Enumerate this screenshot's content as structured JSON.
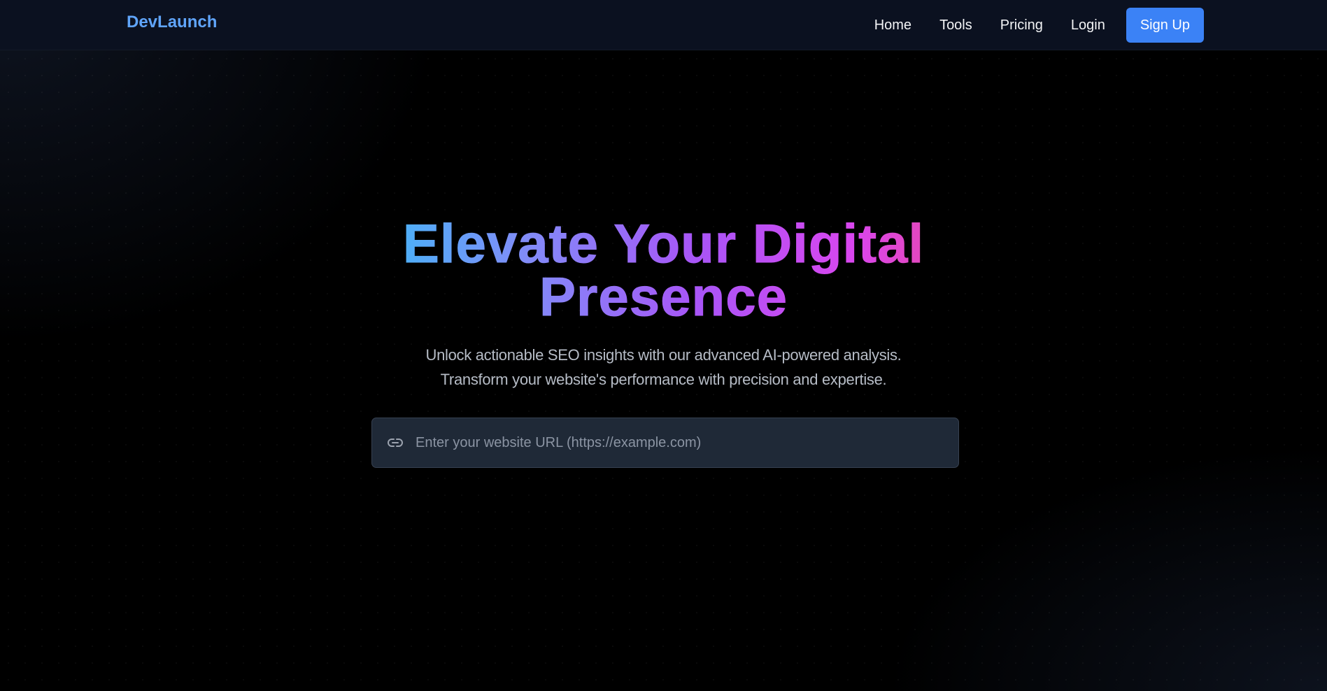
{
  "navbar": {
    "brand": "DevLaunch",
    "links": [
      "Home",
      "Tools",
      "Pricing",
      "Login"
    ],
    "cta": "Sign Up"
  },
  "hero": {
    "headline_line1": "Elevate Your Digital",
    "headline_line2": "Presence",
    "subtitle_line1": "Unlock actionable SEO insights with our advanced AI-powered analysis.",
    "subtitle_line2": "Transform your website's performance with precision and expertise."
  },
  "url_input": {
    "icon": "link-icon",
    "placeholder": "Enter your website URL (https://example.com)",
    "value": ""
  },
  "colors": {
    "brand": "#60a5fa",
    "cta_bg": "#3b82f6",
    "gradient": [
      "#38bdf8",
      "#818cf8",
      "#a855f7",
      "#d946ef",
      "#ec4899"
    ]
  }
}
